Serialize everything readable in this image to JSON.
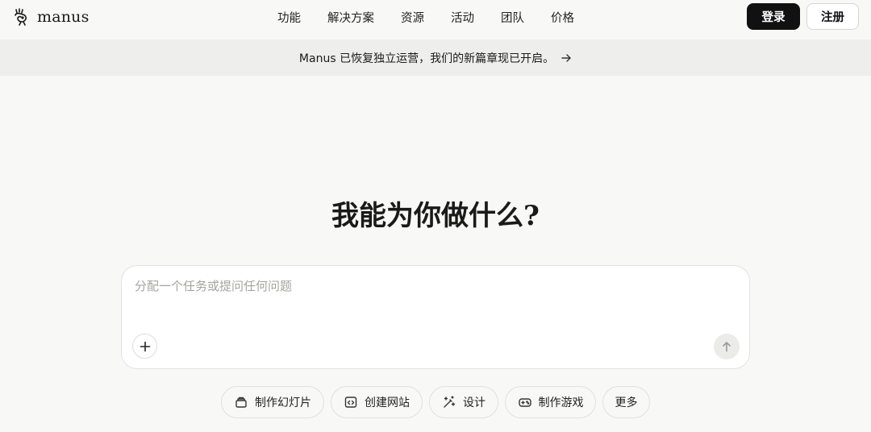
{
  "header": {
    "brand": "manus",
    "nav": [
      {
        "label": "功能"
      },
      {
        "label": "解决方案"
      },
      {
        "label": "资源"
      },
      {
        "label": "活动"
      },
      {
        "label": "团队"
      },
      {
        "label": "价格"
      }
    ],
    "login_label": "登录",
    "register_label": "注册"
  },
  "banner": {
    "text": "Manus 已恢复独立运营，我们的新篇章现已开启。",
    "icon": "arrow-right-icon"
  },
  "hero": {
    "title": "我能为你做什么?"
  },
  "composer": {
    "placeholder": "分配一个任务或提问任何问题",
    "value": "",
    "add_icon": "plus-icon",
    "send_icon": "arrow-up-icon"
  },
  "quick_actions": [
    {
      "label": "制作幻灯片",
      "icon": "slides-icon"
    },
    {
      "label": "创建网站",
      "icon": "code-window-icon"
    },
    {
      "label": "设计",
      "icon": "magic-wand-icon"
    },
    {
      "label": "制作游戏",
      "icon": "gamepad-icon"
    },
    {
      "label": "更多",
      "icon": ""
    }
  ],
  "colors": {
    "background": "#f8f8f7",
    "banner_bg": "#eeeeec",
    "primary_button": "#111111",
    "placeholder": "#a4a4a2"
  }
}
